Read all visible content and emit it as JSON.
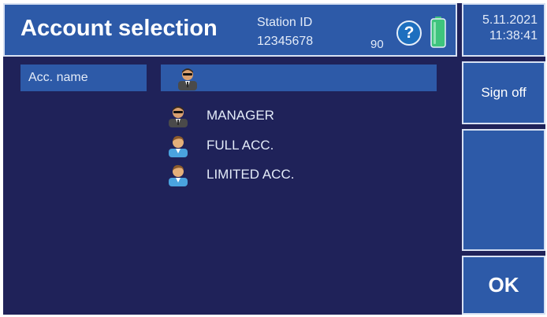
{
  "header": {
    "title": "Account selection",
    "station_label": "Station ID",
    "station_id": "12345678",
    "battery_value": "90",
    "help_symbol": "?"
  },
  "datetime": {
    "date": "5.11.2021",
    "time": "11:38:41"
  },
  "buttons": {
    "sign_off": "Sign off",
    "ok": "OK"
  },
  "list": {
    "header_label": "Acc. name",
    "items": [
      {
        "label": "MANAGER",
        "icon": "manager-user-icon"
      },
      {
        "label": "FULL ACC.",
        "icon": "user-icon"
      },
      {
        "label": "LIMITED ACC.",
        "icon": "user-icon"
      }
    ]
  },
  "colors": {
    "background": "#1f2259",
    "panel": "#2d5aa8",
    "border": "#d7e1f3",
    "battery": "#3ec47d"
  }
}
